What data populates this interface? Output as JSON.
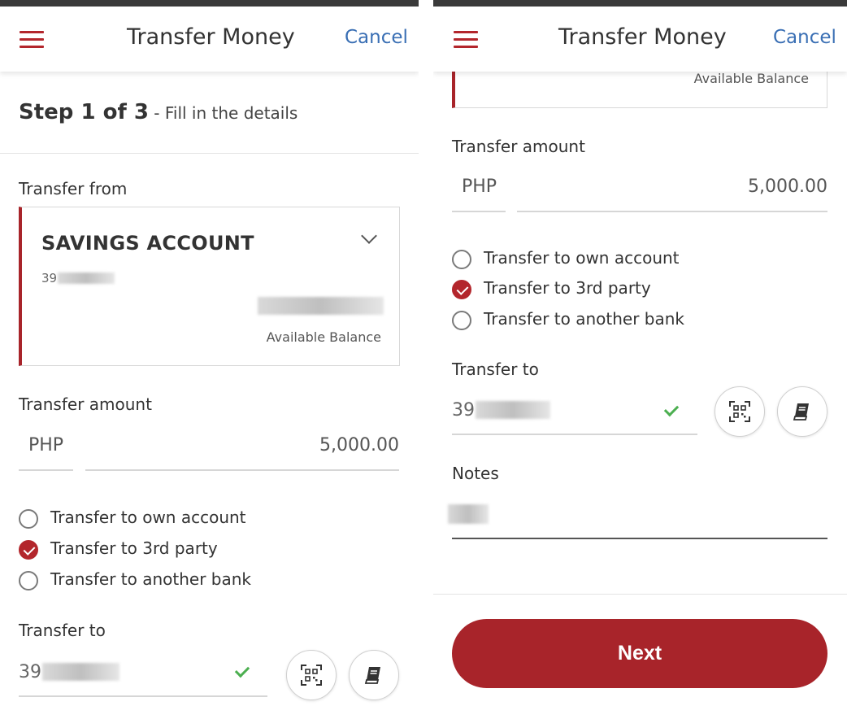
{
  "header": {
    "title": "Transfer Money",
    "cancel_label": "Cancel"
  },
  "step": {
    "main": "Step 1 of 3",
    "sub": " - Fill in the details"
  },
  "transfer_from": {
    "label": "Transfer from",
    "account_name": "SAVINGS ACCOUNT",
    "account_number_prefix": "39",
    "balance_label": "Available Balance"
  },
  "transfer_amount": {
    "label": "Transfer amount",
    "currency": "PHP",
    "value": "5,000.00"
  },
  "transfer_options": [
    {
      "label": "Transfer to own account",
      "checked": false
    },
    {
      "label": "Transfer to 3rd party",
      "checked": true
    },
    {
      "label": "Transfer to another bank",
      "checked": false
    }
  ],
  "transfer_to": {
    "label": "Transfer to",
    "value_prefix": "39"
  },
  "notes": {
    "label": "Notes"
  },
  "next_label": "Next",
  "colors": {
    "accent": "#a8242a",
    "link": "#3a6fb4",
    "valid": "#4caf50"
  },
  "icons": [
    "menu-icon",
    "chevron-down-icon",
    "check-icon",
    "qr-code-icon",
    "address-book-icon"
  ]
}
